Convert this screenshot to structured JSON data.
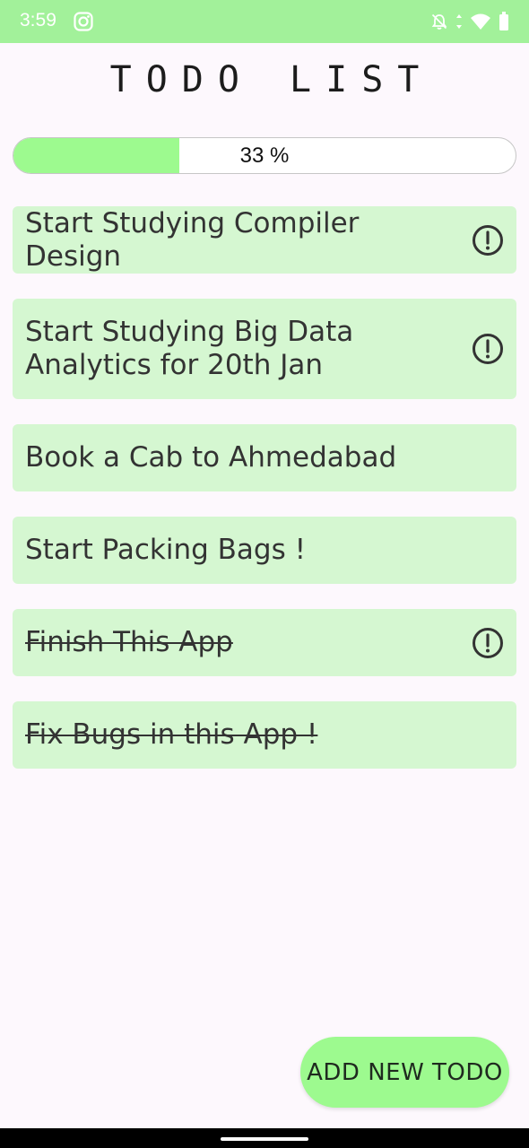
{
  "status_bar": {
    "time": "3:59",
    "background_color": "#A2F19A",
    "icons": [
      "instagram-icon",
      "bell-off-icon",
      "data-arrows-icon",
      "wifi-icon",
      "battery-icon"
    ]
  },
  "app": {
    "title": "TODO LIST"
  },
  "progress": {
    "value": 0.33,
    "label": "33 %",
    "fill_color": "#9DFA8F"
  },
  "todos": [
    {
      "text": "Start Studying Compiler Design",
      "done": false,
      "important": true
    },
    {
      "text": "Start Studying Big Data Analytics for 20th Jan",
      "done": false,
      "important": true
    },
    {
      "text": "Book a Cab to Ahmedabad",
      "done": false,
      "important": false
    },
    {
      "text": "Start Packing Bags !",
      "done": false,
      "important": false
    },
    {
      "text": "Finish This App",
      "done": true,
      "important": true
    },
    {
      "text": "Fix Bugs in this App !",
      "done": true,
      "important": false
    }
  ],
  "fab": {
    "label": "ADD NEW TODO"
  },
  "colors": {
    "item_background": "#D5F7D1",
    "page_background": "#FDF8FD",
    "accent": "#9DFA8F"
  }
}
